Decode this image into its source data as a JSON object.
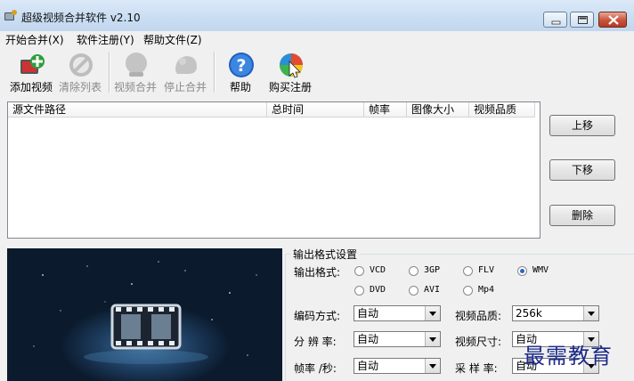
{
  "window": {
    "title": "超级视频合并软件 v2.10"
  },
  "menu": [
    "开始合并(X)",
    "软件注册(Y)",
    "帮助文件(Z)"
  ],
  "toolbar": {
    "add": "添加视频",
    "clear": "清除列表",
    "merge": "视频合并",
    "stop": "停止合并",
    "help": "帮助",
    "buy": "购买注册"
  },
  "file_list": {
    "columns": [
      "源文件路径",
      "总时间",
      "帧率",
      "图像大小",
      "视频品质"
    ],
    "rows": []
  },
  "side_buttons": {
    "up": "上移",
    "down": "下移",
    "delete": "删除"
  },
  "output": {
    "group_title": "输出格式设置",
    "format_label": "输出格式:",
    "formats": [
      "VCD",
      "3GP",
      "FLV",
      "WMV",
      "DVD",
      "AVI",
      "Mp4"
    ],
    "selected_format": "WMV",
    "encoding_label": "编码方式:",
    "encoding_value": "自动",
    "quality_label": "视频品质:",
    "quality_value": "256k",
    "resolution_label": "分 辨 率:",
    "resolution_value": "自动",
    "size_label": "视频尺寸:",
    "size_value": "自动",
    "framerate_label": "帧率 /秒:",
    "framerate_value": "自动",
    "samplerate_label": "采 样 率:",
    "samplerate_value": "自动"
  },
  "watermark": "最需教育"
}
